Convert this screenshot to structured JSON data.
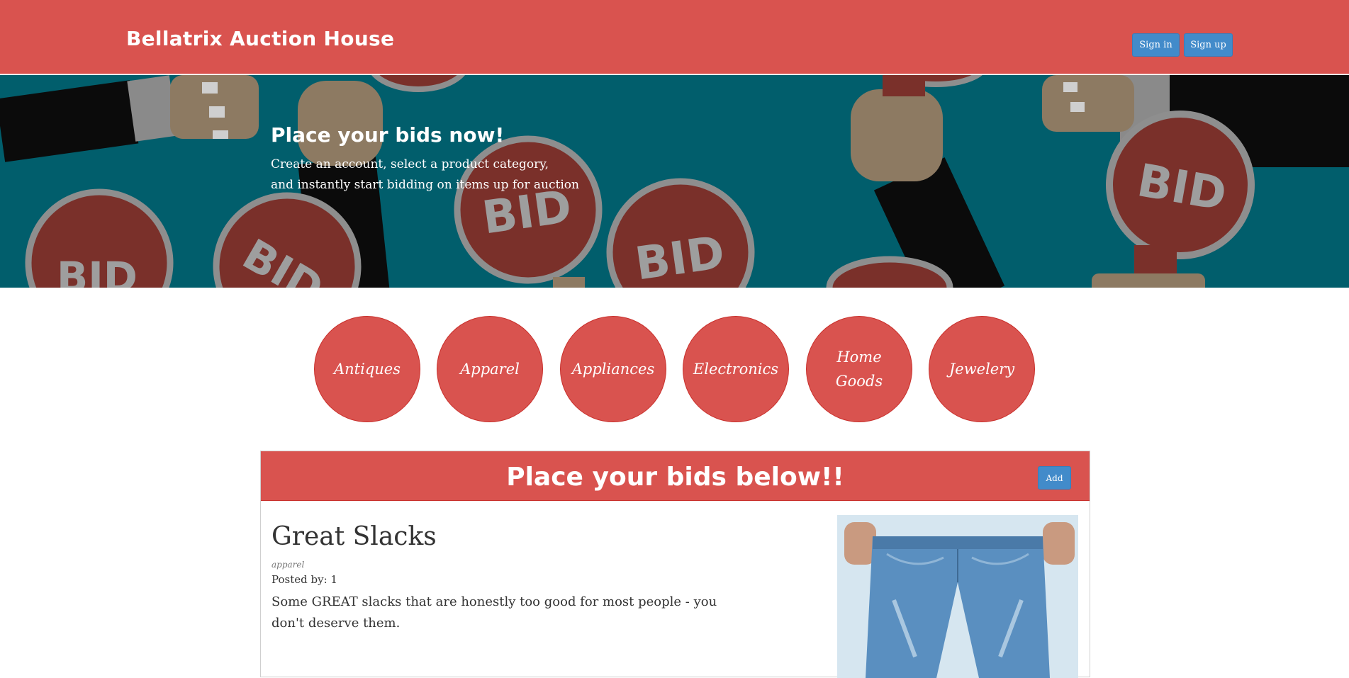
{
  "navbar": {
    "brand": "Bellatrix Auction House",
    "signin_label": "Sign in",
    "signup_label": "Sign up"
  },
  "hero": {
    "title": "Place your bids now!",
    "line1": "Create an account, select a product category,",
    "line2": "and instantly start bidding on items up for auction",
    "sign_text": "BID"
  },
  "categories": [
    "Antiques",
    "Apparel",
    "Appliances",
    "Electronics",
    "Home Goods",
    "Jewelery"
  ],
  "panel": {
    "title": "Place your bids below!!",
    "add_label": "Add"
  },
  "item": {
    "title": "Great Slacks",
    "category": "apparel",
    "posted_by": "Posted by: 1",
    "description": "Some GREAT slacks that are honestly too good for most people - you don't deserve them."
  },
  "colors": {
    "primary": "#d9534f",
    "button": "#428bca",
    "hero_bg": "#015e6c"
  }
}
